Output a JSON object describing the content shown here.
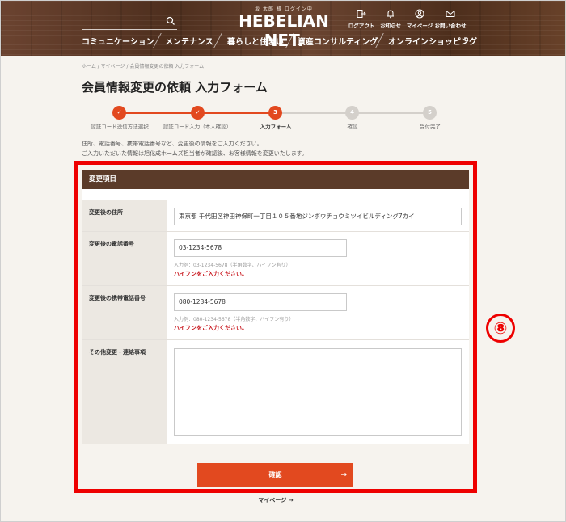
{
  "header": {
    "user_greeting": "坂 太郎 様 ログイン中",
    "logo": "HEBELIAN NET.",
    "links": [
      {
        "label": "ログアウト",
        "icon": "logout-icon"
      },
      {
        "label": "お知らせ",
        "icon": "bell-icon"
      },
      {
        "label": "マイページ",
        "icon": "user-icon"
      },
      {
        "label": "お問い合わせ",
        "icon": "mail-icon"
      }
    ],
    "nav": [
      "コミュニケーション",
      "メンテナンス",
      "暮らしと住まい",
      "資産コンサルティング",
      "オンラインショッピング"
    ]
  },
  "breadcrumb": "ホーム / マイページ / 会員情報変更の依頼 入力フォーム",
  "page_title": "会員情報変更の依頼 入力フォーム",
  "steps": [
    {
      "number": "✓",
      "label": "認証コード送信方法選択",
      "state": "done"
    },
    {
      "number": "✓",
      "label": "認証コード入力（本人確認）",
      "state": "done"
    },
    {
      "number": "3",
      "label": "入力フォーム",
      "state": "current"
    },
    {
      "number": "4",
      "label": "確認",
      "state": "todo"
    },
    {
      "number": "5",
      "label": "受付完了",
      "state": "todo"
    }
  ],
  "intro": {
    "line1": "住所、電話番号、携帯電話番号など、変更後の情報をご入力ください。",
    "line2": "ご入力いただいた情報は旭化成ホームズ担当者が確認後、お客様情報を変更いたします。"
  },
  "form": {
    "heading": "変更項目",
    "address_label": "変更後の住所",
    "address_value": "東京都 千代田区神田神保町一丁目１０５番地ジンボウチョウミツイビルディング7カイ",
    "phone_label": "変更後の電話番号",
    "phone_value": "03-1234-5678",
    "phone_hint": "入力例：03-1234-5678（半角数字、ハイフン有り）",
    "phone_error": "ハイフンをご入力ください。",
    "mobile_label": "変更後の携帯電話番号",
    "mobile_value": "080-1234-5678",
    "mobile_hint": "入力例：080-1234-5678（半角数字、ハイフン有り）",
    "mobile_error": "ハイフンをご入力ください。",
    "other_label": "その他変更・連絡事項",
    "other_value": ""
  },
  "confirm_button": "確認",
  "confirm_arrow": "→",
  "annotation_number": "⑧",
  "mypage_link": "マイページ →",
  "colors": {
    "accent": "#e2491f",
    "annotation": "#ee0000",
    "card_header": "#5b3b29",
    "error": "#c8161d"
  }
}
